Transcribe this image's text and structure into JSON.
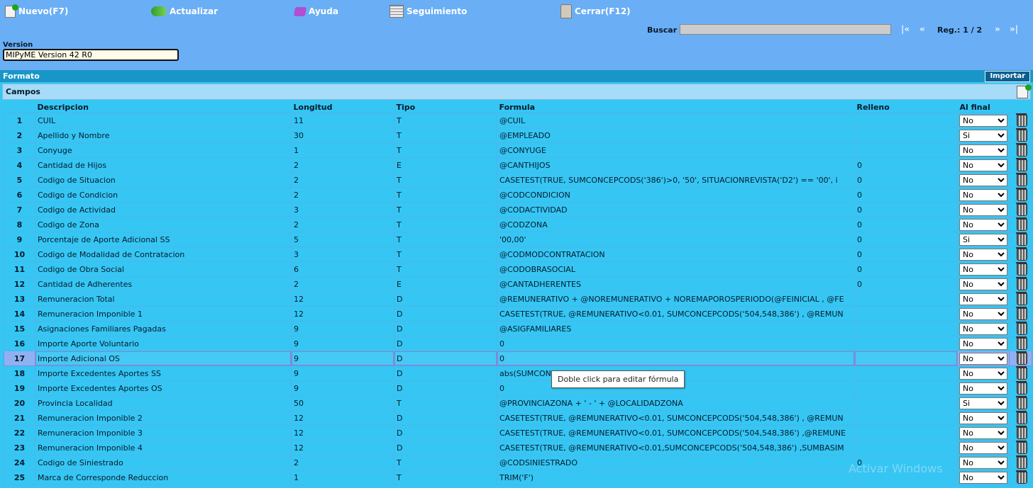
{
  "toolbar": {
    "nuevo": "Nuevo(F7)",
    "actualizar": "Actualizar",
    "ayuda": "Ayuda",
    "seguimiento": "Seguimiento",
    "cerrar": "Cerrar(F12)"
  },
  "search": {
    "label": "Buscar",
    "value": "",
    "first": "|«",
    "prev": "«",
    "reg": "Reg.: 1 / 2",
    "next": "»",
    "last": "»|"
  },
  "version": {
    "label": "Version",
    "value": "MIPyME Version 42 R0"
  },
  "formato": {
    "label": "Formato",
    "import_button": "Importar"
  },
  "campos": {
    "label": "Campos",
    "columns": {
      "descripcion": "Descripcion",
      "longitud": "Longitud",
      "tipo": "Tipo",
      "formula": "Formula",
      "relleno": "Relleno",
      "al_final": "Al final"
    },
    "selected_row": 17,
    "rows": [
      {
        "n": "1",
        "desc": "CUIL",
        "len": "11",
        "tipo": "T",
        "formula": "@CUIL",
        "relleno": "",
        "final": "No"
      },
      {
        "n": "2",
        "desc": "Apellido y Nombre",
        "len": "30",
        "tipo": "T",
        "formula": "@EMPLEADO",
        "relleno": "",
        "final": "Si"
      },
      {
        "n": "3",
        "desc": "Conyuge",
        "len": "1",
        "tipo": "T",
        "formula": "@CONYUGE",
        "relleno": "",
        "final": "No"
      },
      {
        "n": "4",
        "desc": "Cantidad de Hijos",
        "len": "2",
        "tipo": "E",
        "formula": "@CANTHIJOS",
        "relleno": "0",
        "final": "No"
      },
      {
        "n": "5",
        "desc": "Codigo de Situacion",
        "len": "2",
        "tipo": "T",
        "formula": "CASETEST(TRUE,  SUMCONCEPCODS('386')>0, '50', SITUACIONREVISTA('D2') == '00', i",
        "relleno": "0",
        "final": "No"
      },
      {
        "n": "6",
        "desc": "Codigo de Condicion",
        "len": "2",
        "tipo": "T",
        "formula": "@CODCONDICION",
        "relleno": "0",
        "final": "No"
      },
      {
        "n": "7",
        "desc": "Codigo de Actividad",
        "len": "3",
        "tipo": "T",
        "formula": "@CODACTIVIDAD",
        "relleno": "0",
        "final": "No"
      },
      {
        "n": "8",
        "desc": "Codigo de Zona",
        "len": "2",
        "tipo": "T",
        "formula": "@CODZONA",
        "relleno": "0",
        "final": "No"
      },
      {
        "n": "9",
        "desc": "Porcentaje de Aporte Adicional SS",
        "len": "5",
        "tipo": "T",
        "formula": "'00,00'",
        "relleno": "0",
        "final": "Si"
      },
      {
        "n": "10",
        "desc": "Codigo de Modalidad de Contratacion",
        "len": "3",
        "tipo": "T",
        "formula": "@CODMODCONTRATACION",
        "relleno": "0",
        "final": "No"
      },
      {
        "n": "11",
        "desc": "Codigo de Obra Social",
        "len": "6",
        "tipo": "T",
        "formula": "@CODOBRASOCIAL",
        "relleno": "0",
        "final": "No"
      },
      {
        "n": "12",
        "desc": "Cantidad de Adherentes",
        "len": "2",
        "tipo": "E",
        "formula": "@CANTADHERENTES",
        "relleno": "0",
        "final": "No"
      },
      {
        "n": "13",
        "desc": "Remuneracion Total",
        "len": "12",
        "tipo": "D",
        "formula": "@REMUNERATIVO + @NOREMUNERATIVO + NOREMAPOROSPERIODO(@FEINICIAL , @FE",
        "relleno": "",
        "final": "No"
      },
      {
        "n": "14",
        "desc": "Remuneracion Imponible 1",
        "len": "12",
        "tipo": "D",
        "formula": "CASETEST(TRUE, @REMUNERATIVO<0.01, SUMCONCEPCODS('504,548,386') , @REMUN",
        "relleno": "",
        "final": "No"
      },
      {
        "n": "15",
        "desc": "Asignaciones Familiares Pagadas",
        "len": "9",
        "tipo": "D",
        "formula": "@ASIGFAMILIARES",
        "relleno": "",
        "final": "No"
      },
      {
        "n": "16",
        "desc": "Importe Aporte Voluntario",
        "len": "9",
        "tipo": "D",
        "formula": "0",
        "relleno": "",
        "final": "No"
      },
      {
        "n": "17",
        "desc": "Importe Adicional OS",
        "len": "9",
        "tipo": "D",
        "formula": "0",
        "relleno": "",
        "final": "No"
      },
      {
        "n": "18",
        "desc": "Importe Excedentes Aportes SS",
        "len": "9",
        "tipo": "D",
        "formula": "abs(SUMCON",
        "relleno": "",
        "final": "No"
      },
      {
        "n": "19",
        "desc": "Importe Excedentes Aportes OS",
        "len": "9",
        "tipo": "D",
        "formula": "0",
        "relleno": "",
        "final": "No"
      },
      {
        "n": "20",
        "desc": "Provincia Localidad",
        "len": "50",
        "tipo": "T",
        "formula": "@PROVINCIAZONA + ' - ' + @LOCALIDADZONA",
        "relleno": "",
        "final": "Si"
      },
      {
        "n": "21",
        "desc": "Remuneracion Imponible 2",
        "len": "12",
        "tipo": "D",
        "formula": " CASETEST(TRUE, @REMUNERATIVO<0.01, SUMCONCEPCODS('504,548,386') , @REMUN",
        "relleno": "",
        "final": "No"
      },
      {
        "n": "22",
        "desc": "Remuneracion Imponible 3",
        "len": "12",
        "tipo": "D",
        "formula": "CASETEST(TRUE, @REMUNERATIVO<0.01, SUMCONCEPCODS('504,548,386') ,@REMUNE",
        "relleno": "",
        "final": "No"
      },
      {
        "n": "23",
        "desc": "Remuneracion Imponible 4",
        "len": "12",
        "tipo": "D",
        "formula": "CASETEST(TRUE, @REMUNERATIVO<0.01,SUMCONCEPCODS('504,548,386') ,SUMBASIM",
        "relleno": "",
        "final": "No"
      },
      {
        "n": "24",
        "desc": "Codigo de Siniestrado",
        "len": "2",
        "tipo": "T",
        "formula": "@CODSINIESTRADO",
        "relleno": "0",
        "final": "No"
      },
      {
        "n": "25",
        "desc": "Marca de Corresponde Reduccion",
        "len": "1",
        "tipo": "T",
        "formula": "TRIM('F')",
        "relleno": "",
        "final": "No"
      }
    ],
    "final_options": [
      "No",
      "Si"
    ]
  },
  "tooltip": "Doble click para editar fórmula",
  "watermark": "Activar Windows"
}
